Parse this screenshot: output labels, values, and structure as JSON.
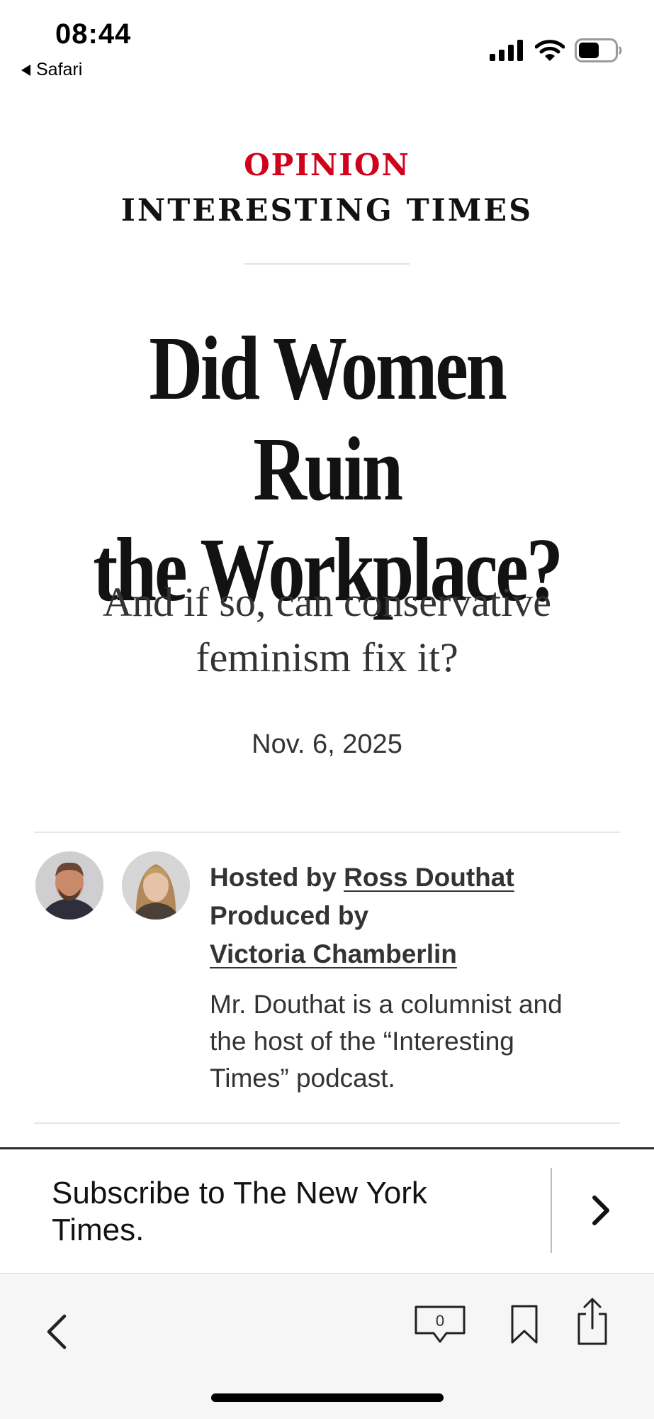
{
  "status_bar": {
    "time": "08:44",
    "back_app": "Safari",
    "battery_level": 0.55
  },
  "header": {
    "kicker": "OPINION",
    "column_name": "INTERESTING TIMES"
  },
  "article": {
    "headline_line1": "Did Women Ruin",
    "headline_line2": "the Workplace?",
    "dek_line1": "And if so, can conservative",
    "dek_line2": "feminism fix it?",
    "date": "Nov. 6, 2025"
  },
  "byline": {
    "hosted_prefix": "Hosted by",
    "host_name": "Ross Douthat",
    "produced_prefix": "Produced by",
    "producer_name": "Victoria Chamberlin",
    "bio_line1": "Mr. Douthat is a columnist and",
    "bio_line2": "the host of the “Interesting",
    "bio_line3": "Times” podcast."
  },
  "subscribe": {
    "line1": "Subscribe to The New York",
    "line2": "Times."
  },
  "toolbar": {
    "comment_count": "0",
    "icons": [
      "back-chevron-icon",
      "comments-icon",
      "bookmark-icon",
      "share-icon"
    ]
  },
  "colors": {
    "opinion_red": "#d0021b",
    "text": "#121212",
    "toolbar_bg": "#f6f6f6"
  }
}
